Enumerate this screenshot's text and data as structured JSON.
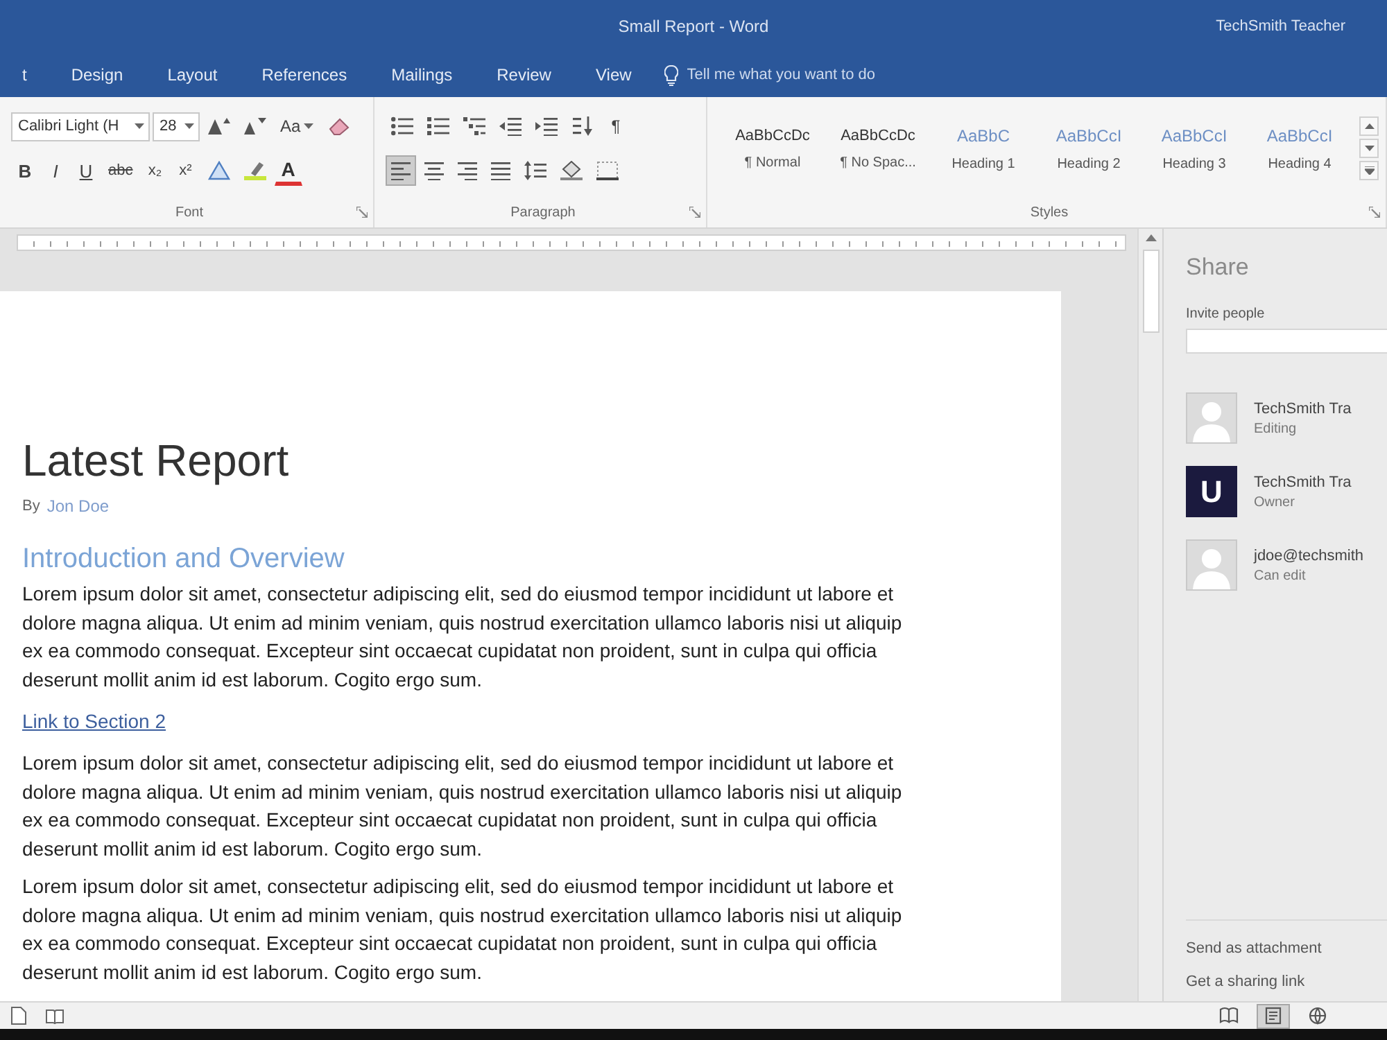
{
  "window": {
    "title": "Small Report - Word",
    "user": "TechSmith Teacher"
  },
  "tabs": [
    {
      "label": "t",
      "selected": false
    },
    {
      "label": "Design",
      "selected": false
    },
    {
      "label": "Layout",
      "selected": false
    },
    {
      "label": "References",
      "selected": false
    },
    {
      "label": "Mailings",
      "selected": false
    },
    {
      "label": "Review",
      "selected": false
    },
    {
      "label": "View",
      "selected": false
    }
  ],
  "tell_me": {
    "placeholder": "Tell me what you want to do"
  },
  "font_group": {
    "label": "Font",
    "font_name": "Calibri Light (H",
    "font_size": "28",
    "case_label": "Aa",
    "format_buttons": [
      {
        "label": "B",
        "kind": "bold"
      },
      {
        "label": "I",
        "kind": "italic"
      },
      {
        "label": "U",
        "kind": "underline"
      },
      {
        "label": "abc",
        "kind": "strike"
      },
      {
        "label": "x₂",
        "kind": "sub"
      },
      {
        "label": "x²",
        "kind": "super"
      }
    ],
    "color_label": "A"
  },
  "paragraph_group": {
    "label": "Paragraph",
    "marks_label": "¶",
    "alignments": [
      {
        "kind": "left",
        "selected": true
      },
      {
        "kind": "center",
        "selected": false
      },
      {
        "kind": "right",
        "selected": false
      },
      {
        "kind": "justify",
        "selected": false
      }
    ]
  },
  "styles_group": {
    "label": "Styles",
    "styles": [
      {
        "preview": "AaBbCcDc",
        "name": "¶ Normal",
        "kind": "body",
        "selected": false
      },
      {
        "preview": "AaBbCcDc",
        "name": "¶ No Spac...",
        "kind": "body",
        "selected": false
      },
      {
        "preview": "AaBbC",
        "name": "Heading 1",
        "kind": "heading",
        "selected": false
      },
      {
        "preview": "AaBbCcI",
        "name": "Heading 2",
        "kind": "heading",
        "selected": false
      },
      {
        "preview": "AaBbCcI",
        "name": "Heading 3",
        "kind": "heading",
        "selected": false
      },
      {
        "preview": "AaBbCcI",
        "name": "Heading 4",
        "kind": "heading",
        "selected": false
      }
    ]
  },
  "document": {
    "title": "Latest Report",
    "byline": {
      "label": "By",
      "author": "Jon Doe"
    },
    "blocks": [
      {
        "kind": "heading",
        "text": "Introduction and Overview"
      },
      {
        "kind": "paragraph",
        "text": "Lorem ipsum dolor sit amet, consectetur adipiscing elit, sed do eiusmod tempor incididunt ut labore et dolore magna aliqua. Ut enim ad minim veniam, quis nostrud exercitation ullamco laboris nisi ut aliquip ex ea commodo consequat. Excepteur sint occaecat cupidatat non proident, sunt in culpa qui officia deserunt mollit anim id est laborum. Cogito ergo sum."
      },
      {
        "kind": "link",
        "text": "Link to Section 2"
      },
      {
        "kind": "paragraph",
        "text": "Lorem ipsum dolor sit amet, consectetur adipiscing elit, sed do eiusmod tempor incididunt ut labore et dolore magna aliqua. Ut enim ad minim veniam, quis nostrud exercitation ullamco laboris nisi ut aliquip ex ea commodo consequat. Excepteur sint occaecat cupidatat non proident, sunt in culpa qui officia deserunt mollit anim id est laborum. Cogito ergo sum."
      },
      {
        "kind": "paragraph",
        "text": "Lorem ipsum dolor sit amet, consectetur adipiscing elit, sed do eiusmod tempor incididunt ut labore et dolore magna aliqua. Ut enim ad minim veniam, quis nostrud exercitation ullamco laboris nisi ut aliquip ex ea commodo consequat. Excepteur sint occaecat cupidatat non proident, sunt in culpa qui officia deserunt mollit anim id est laborum. Cogito ergo sum."
      }
    ]
  },
  "share": {
    "title": "Share",
    "invite_label": "Invite people",
    "people": [
      {
        "name": "TechSmith Tra",
        "role": "Editing",
        "kind": "silhouette"
      },
      {
        "name": "TechSmith Tra",
        "role": "Owner",
        "kind": "initial",
        "initial": "U"
      },
      {
        "name": "jdoe@techsmith",
        "role": "Can edit",
        "kind": "silhouette"
      }
    ],
    "actions": [
      "Send as attachment",
      "Get a sharing link"
    ]
  },
  "status_bar": {
    "views": [
      {
        "kind": "read",
        "selected": false
      },
      {
        "kind": "print",
        "selected": true
      },
      {
        "kind": "web",
        "selected": false
      }
    ]
  }
}
